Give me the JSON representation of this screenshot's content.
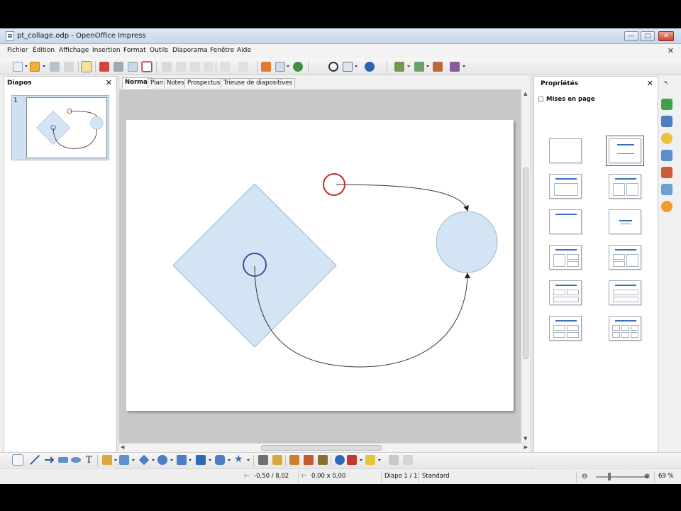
{
  "window": {
    "title": "pt_collage.odp - OpenOffice Impress",
    "minimize": "—",
    "maximize": "□",
    "close": "✕"
  },
  "menu": [
    "Fichier",
    "Édition",
    "Affichage",
    "Insertion",
    "Format",
    "Outils",
    "Diaporama",
    "Fenêtre",
    "Aide"
  ],
  "menu_doc_close": "✕",
  "slides_pane": {
    "title": "Diapos",
    "close": "✕",
    "thumb_number": "1"
  },
  "tabs": [
    "Normal",
    "Plan",
    "Notes",
    "Prospectus",
    "Trieuse de diapositives"
  ],
  "properties": {
    "title": "Propriétés",
    "close": "✕",
    "section": "Mises en page"
  },
  "status": {
    "position": "-0,50 / 8,02",
    "size": "0,00 x 0,00",
    "slide": "Diapo 1 / 1",
    "master": "Standard",
    "zoom": "69 %"
  },
  "colors": {
    "shape_fill": "#d3e5f4",
    "shape_stroke": "#9cb7d1",
    "red_point": "#c0302a",
    "blue_point": "#3e4fa3",
    "connector": "#333333"
  },
  "icons": {
    "toolbar": [
      "new-icon",
      "open-icon",
      "save-icon",
      "email-icon",
      "edit-file-icon",
      "pdf-icon",
      "print-icon",
      "spellcheck-icon",
      "cut-icon",
      "copy-icon",
      "paste-icon",
      "clone-icon",
      "undo-icon",
      "redo-icon",
      "chart-icon",
      "table-icon",
      "globe-icon",
      "navigator-icon",
      "zoom-icon",
      "help-icon"
    ],
    "drawbar": [
      "select-icon",
      "line-icon",
      "arrow-icon",
      "rectangle-icon",
      "ellipse-icon",
      "text-icon",
      "curve-icon",
      "connector-icon",
      "basic-shapes-icon",
      "symbol-shapes-icon",
      "block-arrows-icon",
      "flowchart-icon",
      "callouts-icon",
      "stars-icon",
      "points-icon",
      "glue-points-icon",
      "fontwork-icon",
      "image-icon",
      "gallery-icon",
      "extrusion-icon"
    ]
  }
}
